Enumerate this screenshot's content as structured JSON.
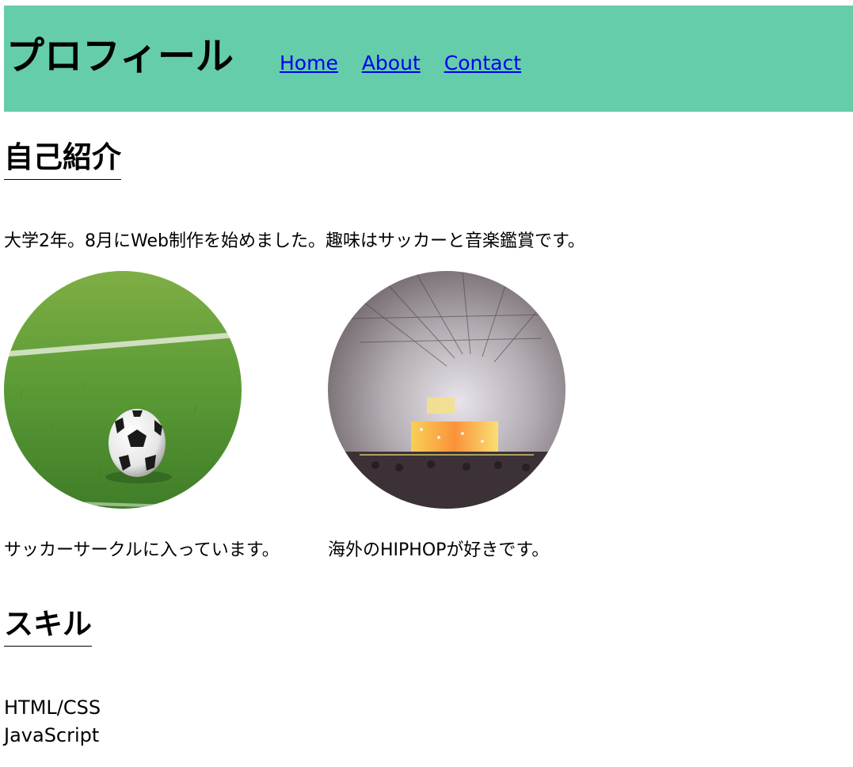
{
  "header": {
    "title": "プロフィール",
    "nav": [
      {
        "label": "Home"
      },
      {
        "label": "About"
      },
      {
        "label": "Contact"
      }
    ],
    "background_color": "#66cdaa"
  },
  "about": {
    "heading": "自己紹介",
    "intro": "大学2年。8月にWeb制作を始めました。趣味はサッカーと音楽鑑賞です。",
    "hobbies": [
      {
        "image": "soccer-ball-on-grass",
        "caption": "サッカーサークルに入っています。"
      },
      {
        "image": "concert-stage-hall",
        "caption": "海外のHIPHOPが好きです。"
      }
    ]
  },
  "skills": {
    "heading": "スキル",
    "items": [
      "HTML/CSS",
      "JavaScript"
    ]
  }
}
